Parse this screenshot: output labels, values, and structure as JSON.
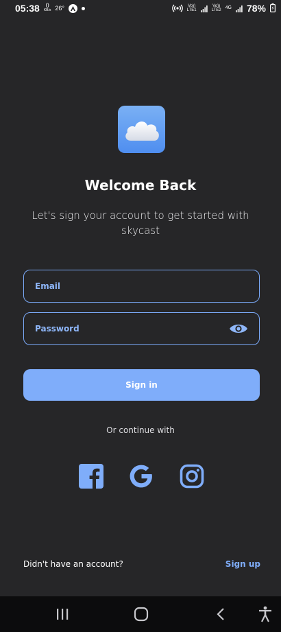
{
  "status_bar": {
    "time": "05:38",
    "data_rate_value": "0",
    "data_rate_unit": "KB/s",
    "temperature": "26°",
    "net1_label": "Vo)) LTE1",
    "net2_label": "Vo)) LTE2",
    "net_type": "4G",
    "battery": "78%"
  },
  "login": {
    "title": "Welcome Back",
    "subtitle": "Let's sign your account to get started with skycast",
    "email_label": "Email",
    "password_label": "Password",
    "signin_label": "Sign in",
    "or_continue": "Or continue with",
    "no_account": "Didn't have an account?",
    "signup_label": "Sign up"
  },
  "colors": {
    "background": "#262628",
    "accent": "#7fadfa",
    "border": "#7aa9f7",
    "nav_bar": "#0c0c0d"
  },
  "icons": {
    "logo": "cloud-icon",
    "password_toggle": "eye-icon",
    "social": [
      "facebook-icon",
      "google-icon",
      "instagram-icon"
    ],
    "nav": [
      "recents-icon",
      "home-icon",
      "back-icon",
      "accessibility-icon"
    ]
  }
}
